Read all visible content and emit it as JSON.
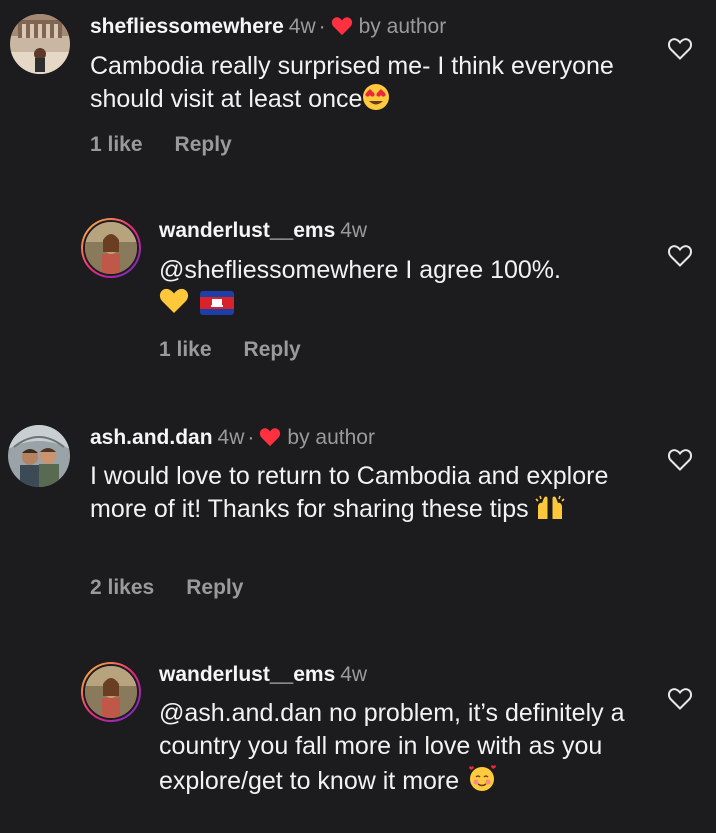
{
  "comments": [
    {
      "username": "shefliessomewhere",
      "time": "4w",
      "author_label": "by author",
      "body": "Cambodia really surprised me- I think everyone should visit at least once",
      "likes": "1 like",
      "reply": "Reply"
    },
    {
      "username": "wanderlust__ems",
      "time": "4w",
      "body": "@shefliessomewhere I agree 100%.",
      "likes": "1 like",
      "reply": "Reply"
    },
    {
      "username": "ash.and.dan",
      "time": "4w",
      "author_label": "by author",
      "body": "I would love to return to Cambodia and explore more of it! Thanks for sharing these tips",
      "likes": "2 likes",
      "reply": "Reply"
    },
    {
      "username": "wanderlust__ems",
      "time": "4w",
      "body": "@ash.and.dan no problem, it’s definitely a country you fall more in love with as you explore/get to know it more"
    }
  ],
  "separator": "·",
  "colors": {
    "background": "#1c1c1e",
    "author_heart": "#ff3040",
    "muted_text": "#9a9a9a"
  },
  "icons": [
    "heart-outline-icon",
    "heart-filled-icon",
    "heart-eyes-emoji",
    "yellow-heart-emoji",
    "cambodia-flag-emoji",
    "raising-hands-emoji",
    "smiling-hearts-emoji"
  ]
}
